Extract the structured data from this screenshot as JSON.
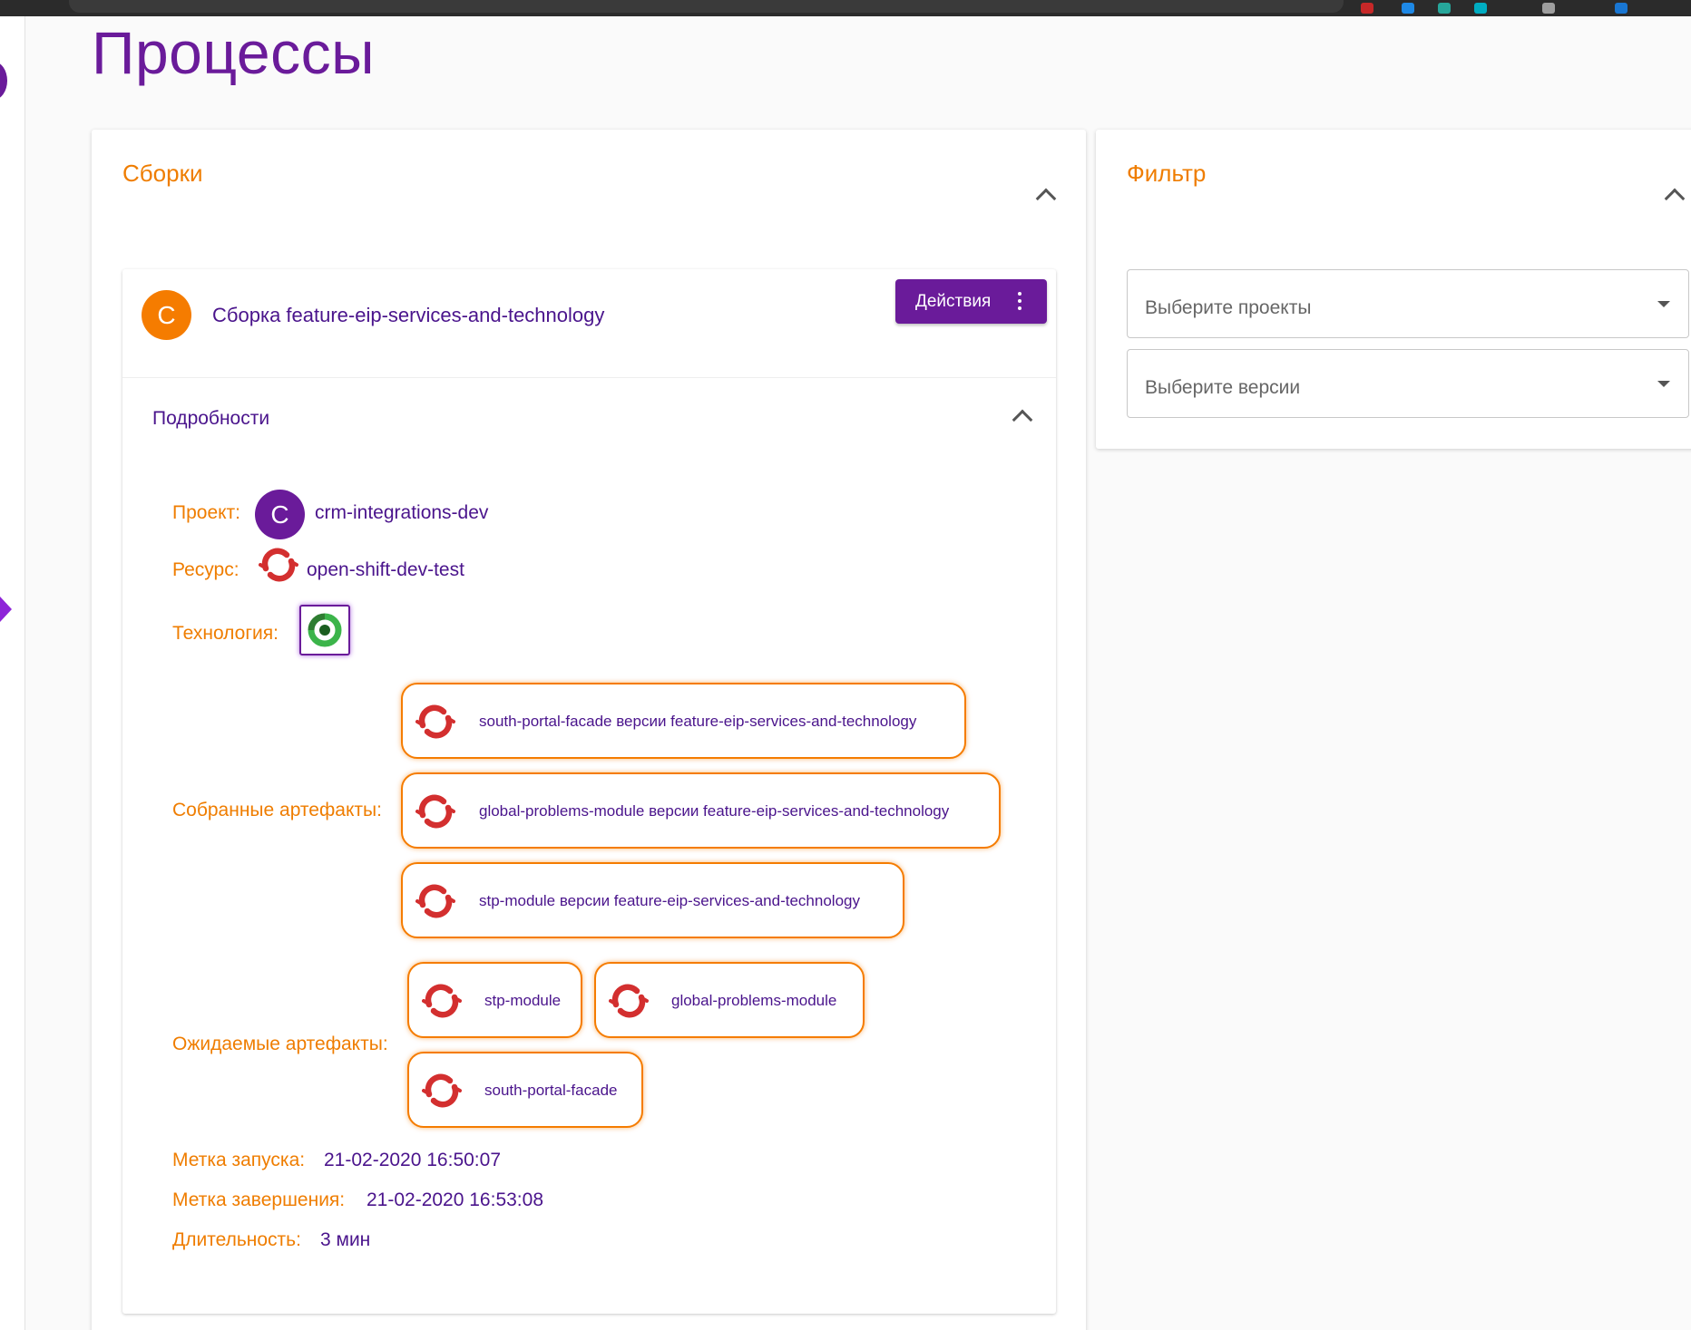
{
  "page": {
    "title": "Процессы"
  },
  "builds_card": {
    "title": "Сборки",
    "build": {
      "avatar_letter": "C",
      "name": "Сборка feature-eip-services-and-technology",
      "actions_label": "Действия",
      "details": {
        "title": "Подробности",
        "project_label": "Проект:",
        "project_avatar_letter": "C",
        "project_value": "crm-integrations-dev",
        "resource_label": "Ресурс:",
        "resource_value": "open-shift-dev-test",
        "technology_label": "Технология:",
        "built_label": "Собранные артефакты:",
        "built_artifacts": [
          "south-portal-facade версии feature-eip-services-and-technology",
          "global-problems-module версии feature-eip-services-and-technology",
          "stp-module версии feature-eip-services-and-technology"
        ],
        "expected_label": "Ожидаемые артефакты:",
        "expected_artifacts": [
          "stp-module",
          "global-problems-module",
          "south-portal-facade"
        ],
        "start_label": "Метка запуска:",
        "start_value": "21-02-2020 16:50:07",
        "end_label": "Метка завершения:",
        "end_value": "21-02-2020 16:53:08",
        "duration_label": "Длительность:",
        "duration_value": "3 мин"
      }
    }
  },
  "filter_card": {
    "title": "Фильтр",
    "projects_placeholder": "Выберите проекты",
    "versions_placeholder": "Выберите версии"
  },
  "icons": {
    "resource": "openshift-icon",
    "technology": "circleci-icon",
    "expand": "chevron-up-icon",
    "menu": "kebab-menu-icon",
    "select": "caret-down-icon"
  },
  "colors": {
    "primary": "#6a1b9a",
    "accent": "#ef7d00",
    "openshift": "#d32f2f",
    "technology": "#3bb44a"
  }
}
